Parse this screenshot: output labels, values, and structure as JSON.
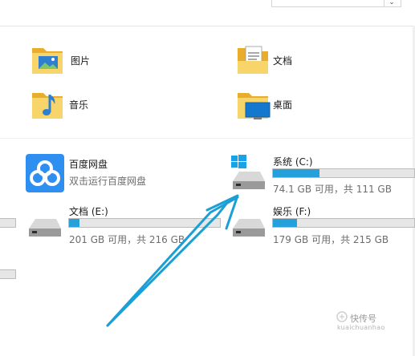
{
  "folders": [
    {
      "name": "图片",
      "icon": "pictures-folder-icon"
    },
    {
      "name": "文档",
      "icon": "documents-folder-icon"
    },
    {
      "name": "音乐",
      "icon": "music-folder-icon"
    },
    {
      "name": "桌面",
      "icon": "desktop-folder-icon"
    }
  ],
  "apps": [
    {
      "name": "百度网盘",
      "subtitle": "双击运行百度网盘",
      "icon": "baidu-netdisk-icon"
    }
  ],
  "drives": [
    {
      "name": "系统 (C:)",
      "free_text": "74.1 GB 可用，共 111 GB",
      "used_fraction": 0.33,
      "icon": "windows-drive-icon"
    },
    {
      "name": "文档 (E:)",
      "free_text": "201 GB 可用，共 216 GB",
      "used_fraction": 0.07,
      "icon": "hard-drive-icon"
    },
    {
      "name": "娱乐 (F:)",
      "free_text": "179 GB 可用，共 215 GB",
      "used_fraction": 0.17,
      "icon": "hard-drive-icon"
    }
  ],
  "annotation": {
    "arrow_color": "#1a9fd6"
  },
  "colors": {
    "accent": "#26a0da",
    "folder": "#f4c74e",
    "baidu": "#2f8ff0"
  },
  "watermark": {
    "text": "快传号",
    "url": "kuaichuanhao"
  }
}
